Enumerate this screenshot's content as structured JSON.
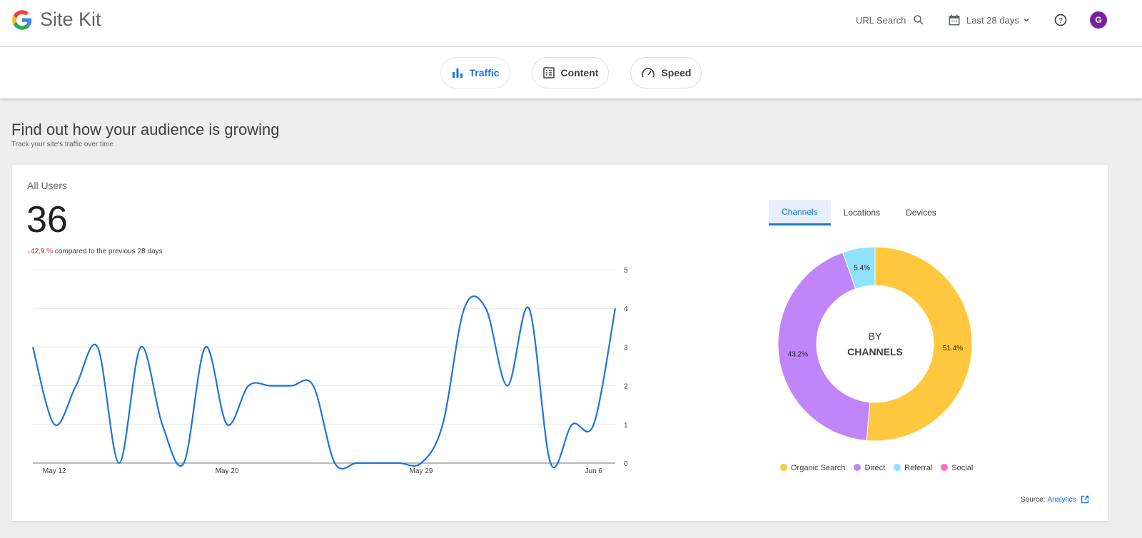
{
  "header": {
    "app_title": "Site Kit",
    "url_search": "URL Search",
    "date_range": "Last 28 days",
    "avatar_letter": "G"
  },
  "nav": [
    {
      "label": "Traffic",
      "icon": "bar-chart-icon",
      "active": true
    },
    {
      "label": "Content",
      "icon": "article-icon",
      "active": false
    },
    {
      "label": "Speed",
      "icon": "speedometer-icon",
      "active": false
    }
  ],
  "section": {
    "title": "Find out how your audience is growing",
    "subtitle": "Track your site's traffic over time"
  },
  "metric": {
    "label": "All Users",
    "value": "36",
    "change": "42,9 %",
    "change_text": "compared to the previous 28 days",
    "change_color": "#d93025"
  },
  "tabs": [
    "Channels",
    "Locations",
    "Devices"
  ],
  "source": {
    "label": "Source:",
    "link": "Analytics"
  },
  "chart_data": [
    {
      "type": "line",
      "x_tick_labels": [
        "May 12",
        "May 20",
        "May 29",
        "Jun 6"
      ],
      "y_ticks": [
        0,
        1,
        2,
        3,
        4,
        5
      ],
      "ylim": [
        0,
        5
      ],
      "grid": true,
      "color": "#1a73e8",
      "x": [
        "May 11",
        "May 12",
        "May 13",
        "May 14",
        "May 15",
        "May 16",
        "May 17",
        "May 18",
        "May 19",
        "May 20",
        "May 21",
        "May 22",
        "May 23",
        "May 24",
        "May 25",
        "May 26",
        "May 27",
        "May 28",
        "May 29",
        "May 30",
        "May 31",
        "Jun 1",
        "Jun 2",
        "Jun 3",
        "Jun 4",
        "Jun 5",
        "Jun 6",
        "Jun 7"
      ],
      "values": [
        3,
        1,
        2,
        3,
        0,
        3,
        1,
        0,
        3,
        1,
        2,
        2,
        2,
        2,
        0,
        0,
        0,
        0,
        0,
        1,
        4,
        4,
        2,
        4,
        0,
        1,
        1,
        4
      ]
    },
    {
      "type": "pie",
      "center_label_1": "BY",
      "center_label_2": "CHANNELS",
      "legend_placement": "bottom",
      "slices": [
        {
          "name": "Organic Search",
          "value": 51.4,
          "label": "51.4%",
          "color": "#ffc73d"
        },
        {
          "name": "Direct",
          "value": 43.2,
          "label": "43.2%",
          "color": "#bf85f9"
        },
        {
          "name": "Referral",
          "value": 5.4,
          "label": "5.4%",
          "color": "#8fe2fb"
        },
        {
          "name": "Social",
          "value": 0,
          "label": "",
          "color": "#ff6fb4"
        }
      ]
    }
  ]
}
